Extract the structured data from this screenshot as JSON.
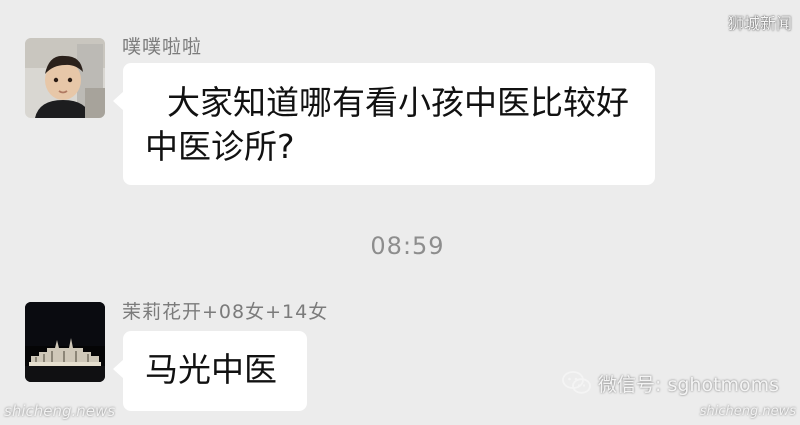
{
  "watermarks": {
    "top_right": "狮城新闻",
    "bottom_left": "shicheng.news",
    "bottom_right": "shicheng.news",
    "wechat_label": "微信号: sghotmoms"
  },
  "messages": [
    {
      "sender": "噗噗啦啦",
      "avatar": "toddler-photo",
      "lines": [
        "大家知道哪有看小孩中医比较好",
        "中医诊所?"
      ]
    },
    {
      "sender": "茉莉花开+08女+14女",
      "avatar": "night-building-photo",
      "lines": [
        "马光中医"
      ]
    }
  ],
  "timestamp": "08:59",
  "colors": {
    "chat_background": "#ececec",
    "bubble": "#ffffff",
    "sender_name": "#7b7b7b",
    "timestamp": "#8d8d8d"
  }
}
